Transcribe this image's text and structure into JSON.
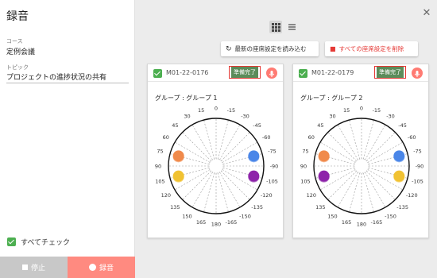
{
  "sidebar": {
    "title": "録音",
    "course_label": "コース",
    "course_value": "定例会議",
    "topic_label": "トピック",
    "topic_value": "プロジェクトの進捗状況の共有",
    "check_all_label": "すべてチェック",
    "stop_label": "停止",
    "record_label": "録音"
  },
  "close_icon": "close-icon",
  "toolbar": {
    "reload_label": "最新の座席設定を読み込む",
    "delete_label": "すべての座席設定を削除",
    "view_mode": "grid"
  },
  "colors": {
    "green": "#4caf50",
    "ready_bg": "#5b8c5a",
    "accent_red": "#e53935",
    "record_bg": "#ff8a80",
    "orange": "#f08a4b",
    "blue": "#4a86e8",
    "yellow": "#f1c232",
    "purple": "#8e24aa"
  },
  "angle_labels": [
    "0",
    "15",
    "30",
    "45",
    "60",
    "75",
    "90",
    "105",
    "120",
    "135",
    "150",
    "165",
    "180",
    "-165",
    "-150",
    "-135",
    "-120",
    "-105",
    "-90",
    "-75",
    "-60",
    "-45",
    "-30",
    "-15"
  ],
  "devices": [
    {
      "id": "M01-22-0176",
      "status": "準備完了",
      "group": "グループ : グループ 1",
      "seats": [
        {
          "color": "orange",
          "angle": 75
        },
        {
          "color": "blue",
          "angle": -75
        },
        {
          "color": "yellow",
          "angle": 105
        },
        {
          "color": "purple",
          "angle": -105
        }
      ]
    },
    {
      "id": "M01-22-0179",
      "status": "準備完了",
      "group": "グループ : グループ 2",
      "seats": [
        {
          "color": "orange",
          "angle": 75
        },
        {
          "color": "blue",
          "angle": -75
        },
        {
          "color": "purple",
          "angle": 105
        },
        {
          "color": "yellow",
          "angle": -105
        }
      ]
    }
  ]
}
